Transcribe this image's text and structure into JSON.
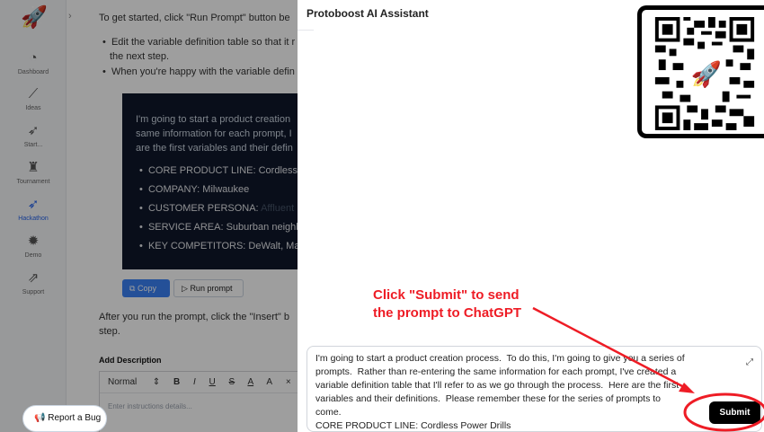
{
  "sidebar": {
    "logo_icon": "rocket-icon",
    "collapse_icon": "›",
    "items": [
      {
        "label": "Dashboard",
        "icon": "dashboard-icon",
        "glyph": "◔"
      },
      {
        "label": "Ideas",
        "icon": "ideas-icon",
        "glyph": "⟋"
      },
      {
        "label": "Start...",
        "icon": "start-icon",
        "glyph": "➶"
      },
      {
        "label": "Tournament",
        "icon": "tournament-icon",
        "glyph": "♜"
      },
      {
        "label": "Hackathon",
        "icon": "hackathon-icon",
        "glyph": "➶"
      },
      {
        "label": "Demo",
        "icon": "demo-icon",
        "glyph": "✹"
      },
      {
        "label": "Support",
        "icon": "support-icon",
        "glyph": "⇗"
      }
    ]
  },
  "content": {
    "intro": "To get started, click \"Run Prompt\" button be",
    "bullets": [
      "Edit the variable definition table so that it r",
      "the next step.",
      "When you're happy with the variable defin"
    ],
    "code_lines": [
      "I'm going to start a product creation",
      "same information for each prompt, I",
      "are the first variables and their defin"
    ],
    "code_bullets": [
      {
        "text": "CORE PRODUCT LINE: Cordless I",
        "dim": ""
      },
      {
        "text": "COMPANY: Milwaukee",
        "dim": ""
      },
      {
        "text": "CUSTOMER PERSONA: ",
        "dim": "Affluent h"
      },
      {
        "text": "SERVICE AREA: Suburban neighb",
        "dim": ""
      },
      {
        "text": "KEY COMPETITORS: DeWalt, Mak",
        "dim": ""
      }
    ],
    "copy_label": "Copy",
    "run_label": "Run prompt",
    "after_text_1": "After you run the prompt, click the \"Insert\" b",
    "after_text_2": "step.",
    "add_description_label": "Add Description",
    "toolbar": {
      "style_select": "Normal",
      "bold": "B",
      "italic": "I",
      "underline": "U",
      "strike": "S",
      "font_color": "A",
      "highlight": "A",
      "more": "×"
    },
    "editor_placeholder": "Enter instructions details...",
    "report_bug_label": "Report a Bug"
  },
  "panel": {
    "title": "Protoboost AI Assistant",
    "annotation_line1": "Click \"Submit\" to send",
    "annotation_line2": "the prompt to ChatGPT",
    "prompt_text": "I'm going to start a product creation process.  To do this, I'm going to give you a series of prompts.  Rather than re-entering the same information for each prompt, I've created a variable definition table that I'll refer to as we go through the process.  Here are the first variables and their definitions.  Please remember these for the series of prompts to come.\nCORE PRODUCT LINE: Cordless Power Drills",
    "submit_label": "Submit",
    "expand_icon": "expand-icon"
  },
  "colors": {
    "annotation_red": "#ee1c25",
    "copy_blue": "#3b82f6",
    "code_bg": "#0f172a"
  }
}
